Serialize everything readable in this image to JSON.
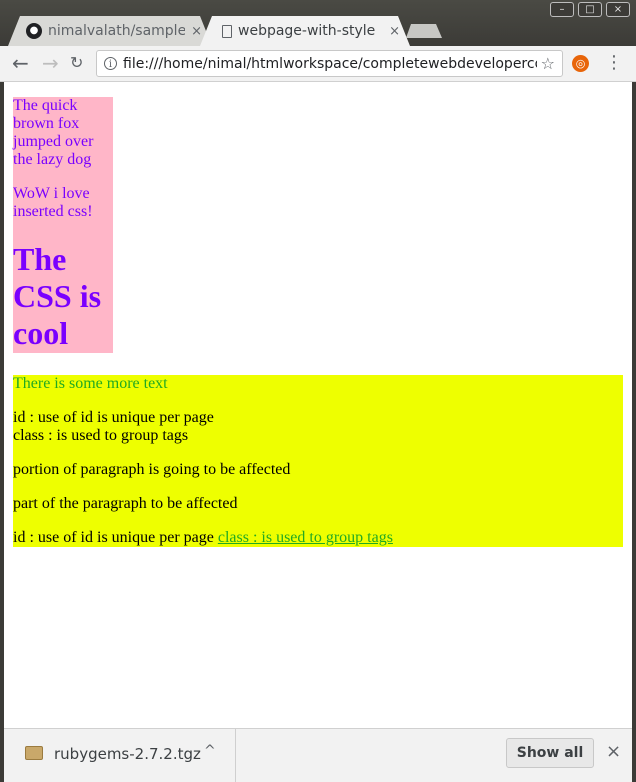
{
  "browser": {
    "tabs": [
      {
        "title": "nimalvalath/sample",
        "close": "×",
        "icon": "github-icon"
      },
      {
        "title": "webpage-with-style",
        "close": "×",
        "icon": "document-icon"
      }
    ],
    "window_controls": {
      "minimize": "–",
      "maximize": "□",
      "close": "×"
    },
    "nav": {
      "back": "←",
      "forward": "→",
      "reload": "C"
    },
    "url": "file:///home/nimal/htmlworkspace/completewebdeveloperco...",
    "star": "☆",
    "menu": "⋮"
  },
  "page": {
    "pink_box": {
      "para1": "The quick brown fox jumped over the lazy dog",
      "para2": "WoW i love inserted css!",
      "heading": "The CSS is cool",
      "background": "#ffb6c8",
      "text_color": "#7a00ff"
    },
    "yellow_box": {
      "green_line": "There is some more text",
      "id_line": "id : use of id is unique per page",
      "class_line": "class : is used to group tags",
      "portion_line": "portion of paragraph is going to be affected",
      "part_line": "part of the paragraph to be affected",
      "last_line_text": "id : use of id is unique per page",
      "last_line_link": "class : is used to group tags",
      "background": "#eeff00",
      "green": "#22aa22"
    }
  },
  "downloads": {
    "file_name": "rubygems-2.7.2.tgz",
    "chevron": "^",
    "show_all": "Show all",
    "close": "×"
  }
}
